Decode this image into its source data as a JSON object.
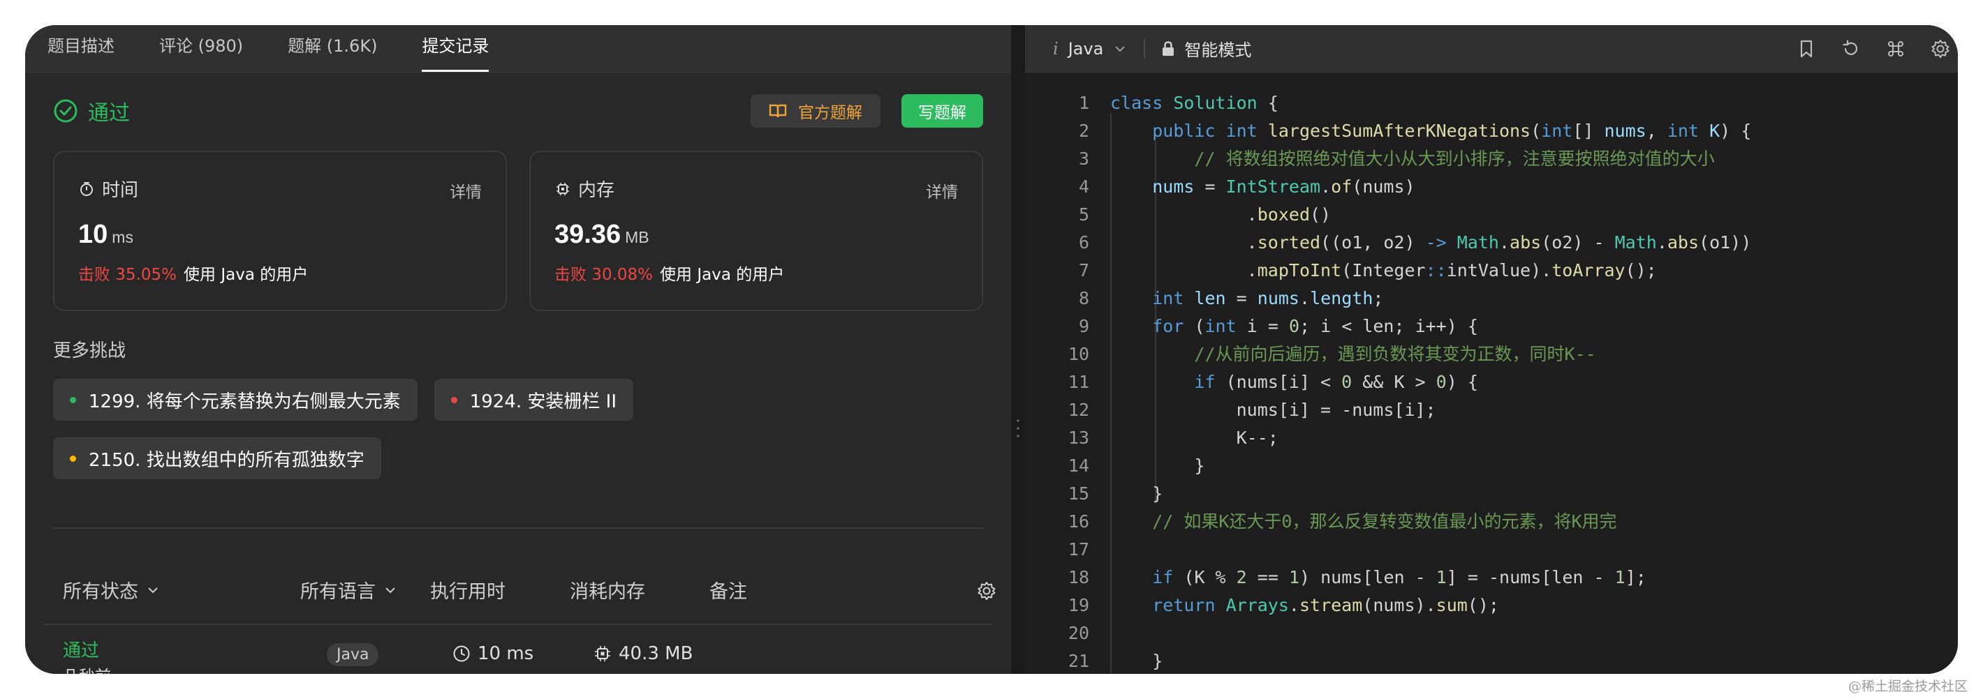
{
  "left": {
    "tabs": [
      {
        "label": "题目描述"
      },
      {
        "label": "评论 (980)"
      },
      {
        "label": "题解 (1.6K)"
      },
      {
        "label": "提交记录"
      }
    ],
    "status": "通过",
    "official_btn": "官方题解",
    "write_btn": "写题解",
    "runtime": {
      "title": "时间",
      "detail": "详情",
      "value": "10",
      "unit": "ms",
      "beat_pct": "击败 35.05%",
      "beat_rest": "使用 Java 的用户"
    },
    "memory": {
      "title": "内存",
      "detail": "详情",
      "value": "39.36",
      "unit": "MB",
      "beat_pct": "击败 30.08%",
      "beat_rest": "使用 Java 的用户"
    },
    "more_title": "更多挑战",
    "challenges": [
      {
        "label": "1299. 将每个元素替换为右侧最大元素",
        "color": "#2cbb5d"
      },
      {
        "label": "1924. 安装栅栏 II",
        "color": "#ef4743"
      },
      {
        "label": "2150. 找出数组中的所有孤独数字",
        "color": "#ffb800"
      }
    ],
    "table": {
      "headers": {
        "status": "所有状态",
        "lang": "所有语言",
        "runtime": "执行用时",
        "memory": "消耗内存",
        "note": "备注"
      },
      "rows": [
        {
          "status": "通过",
          "time": "几秒前",
          "lang": "Java",
          "runtime": "10 ms",
          "memory": "40.3 MB"
        }
      ]
    }
  },
  "editor": {
    "language": "Java",
    "language_prefix": "i",
    "mode": "智能模式",
    "line_numbers": [
      "1",
      "2",
      "3",
      "4",
      "5",
      "6",
      "7",
      "8",
      "9",
      "10",
      "11",
      "12",
      "13",
      "14",
      "15",
      "16",
      "17",
      "18",
      "19",
      "20",
      "21"
    ]
  },
  "colors": {
    "accent_green": "#2cbb5d",
    "orange": "#f0a23b",
    "red": "#ef4743",
    "yellow": "#ffb800"
  },
  "watermark": "@稀土掘金技术社区"
}
